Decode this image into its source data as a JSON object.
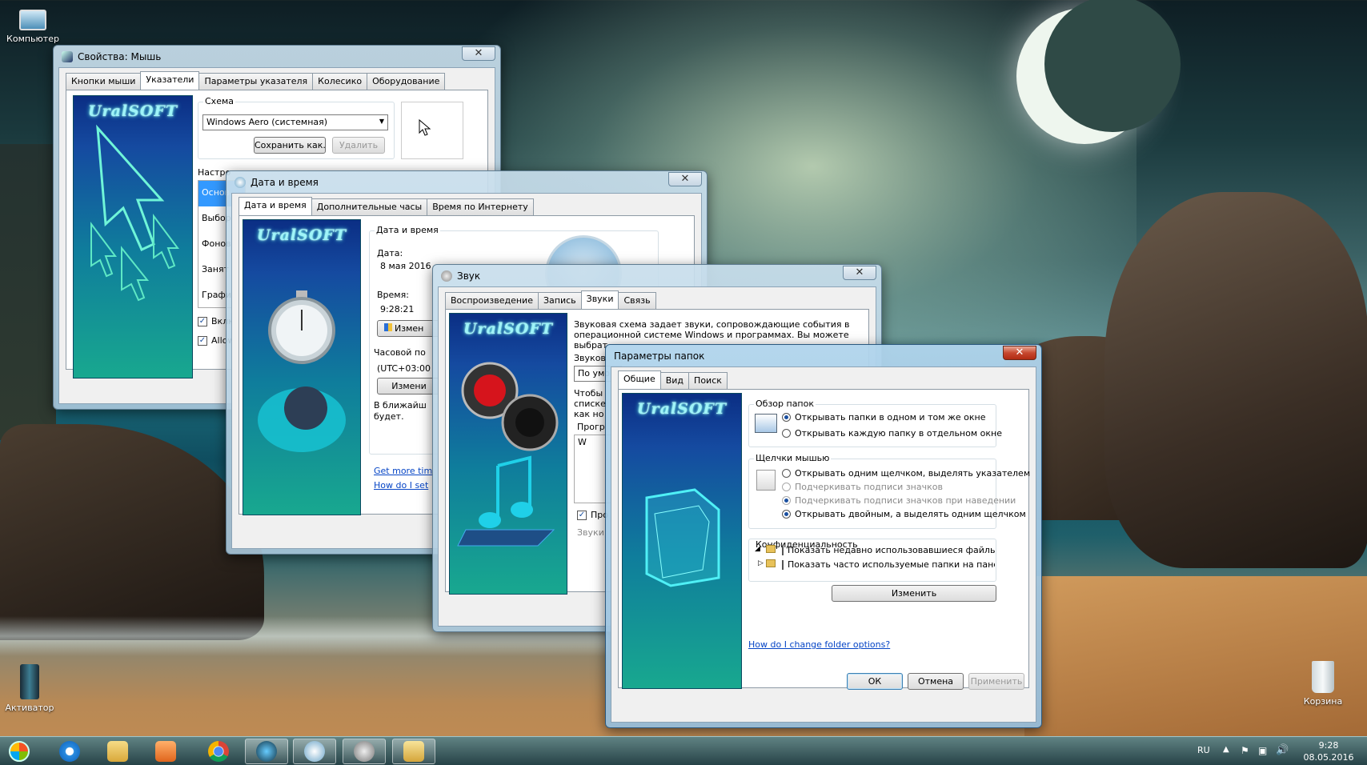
{
  "desktop": {
    "icons": [
      {
        "label": "Компьютер",
        "icon": "computer-icon"
      },
      {
        "label": "Активатор",
        "icon": "activator-icon"
      },
      {
        "label": "Корзина",
        "icon": "recycle-bin-icon"
      }
    ]
  },
  "banner_brand": "UralSOFT",
  "mouse_window": {
    "title": "Свойства: Мышь",
    "tabs": [
      "Кнопки мыши",
      "Указатели",
      "Параметры указателя",
      "Колесико",
      "Оборудование"
    ],
    "selected_tab": "Указатели",
    "scheme_label": "Схема",
    "scheme_value": "Windows Aero (системная)",
    "save_as_button": "Сохранить как...",
    "delete_button": "Удалить",
    "customize_label": "Настро",
    "list_items": [
      "Основ",
      "Выбор",
      "Фонов",
      "Занят",
      "Графи"
    ],
    "checkbox1": "Вклю",
    "checkbox2": "Allow"
  },
  "datetime_window": {
    "title": "Дата и время",
    "tabs": [
      "Дата и время",
      "Дополнительные часы",
      "Время по Интернету"
    ],
    "selected_tab": "Дата и время",
    "group_label": "Дата и время",
    "date_label": "Дата:",
    "date_value": "8 мая 2016",
    "time_label": "Время:",
    "time_value": "9:28:21",
    "change_button": "Измен",
    "timezone_label": "Часовой по",
    "timezone_value": "(UTC+03:00",
    "change_tz_button": "Измени",
    "dst_text_1": "В ближайш",
    "dst_text_2": "будет.",
    "link1": "Get more tim",
    "link2": "How do I set"
  },
  "sound_window": {
    "title": "Звук",
    "tabs": [
      "Воспроизведение",
      "Запись",
      "Звуки",
      "Связь"
    ],
    "selected_tab": "Звуки",
    "description": [
      "Звуковая схема задает звуки, сопровождающие события в",
      "операционной системе Windows и программах. Вы можете",
      "выбрат"
    ],
    "scheme_label": "Звуков",
    "scheme_value": "По умо",
    "text2": [
      "Чтобы",
      "списке",
      "как но"
    ],
    "program_label": "Прогр",
    "tree_item": "W",
    "check_label": "Про",
    "sounds_label": "Звуки"
  },
  "folder_window": {
    "title": "Параметры папок",
    "tabs": [
      "Общие",
      "Вид",
      "Поиск"
    ],
    "selected_tab": "Общие",
    "browse_group": "Обзор папок",
    "browse_options": [
      {
        "label": "Открывать папки в одном и том же окне",
        "checked": true,
        "disabled": false
      },
      {
        "label": "Открывать каждую папку в отдельном окне",
        "checked": false,
        "disabled": false
      }
    ],
    "click_group": "Щелчки мышью",
    "click_options": [
      {
        "label": "Открывать одним щелчком, выделять указателем",
        "checked": false,
        "disabled": false
      },
      {
        "label": "Подчеркивать подписи значков",
        "checked": false,
        "disabled": true
      },
      {
        "label": "Подчеркивать подписи значков при наведении",
        "checked": true,
        "disabled": true
      },
      {
        "label": "Открывать двойным, а выделять одним щелчком",
        "checked": true,
        "disabled": false
      }
    ],
    "privacy_group": "Конфиденциальность",
    "privacy_options": [
      {
        "label": "Показать недавно использовавшиеся файлы на пане",
        "checked": false
      },
      {
        "label": "Показать часто используемые папки на панели быс",
        "checked": false
      }
    ],
    "change_button": "Изменить",
    "help_link": "How do I change folder options?",
    "ok_button": "ОК",
    "cancel_button": "Отмена",
    "apply_button": "Применить"
  },
  "taskbar": {
    "language": "RU",
    "time": "9:28",
    "date": "08.05.2016",
    "items": [
      "start-orb",
      "internet-explorer",
      "explorer",
      "media-player",
      "chrome",
      "mouse-properties",
      "date-time",
      "sound",
      "folder-options"
    ]
  }
}
